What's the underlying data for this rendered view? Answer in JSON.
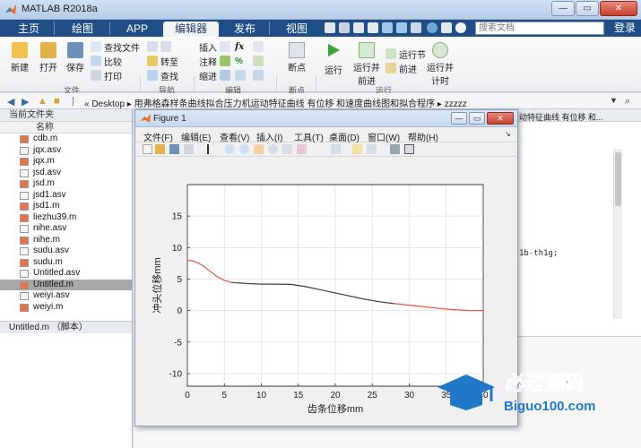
{
  "app": {
    "title": "MATLAB R2018a",
    "window_controls": [
      "—",
      "▭",
      "✕"
    ]
  },
  "ribbon_tabs": [
    {
      "label": "主页",
      "active": false
    },
    {
      "label": "绘图",
      "active": false
    },
    {
      "label": "APP",
      "active": false
    },
    {
      "label": "编辑器",
      "active": true
    },
    {
      "label": "发布",
      "active": false
    },
    {
      "label": "视图",
      "active": false
    }
  ],
  "search": {
    "placeholder": "搜索文档"
  },
  "login_label": "登录",
  "ribbon": {
    "file": {
      "new": "新建",
      "open": "打开",
      "save": "保存",
      "find_files": "查找文件",
      "compare": "比较",
      "print": "打印",
      "group": "文件"
    },
    "navigate": {
      "goto": "转至",
      "find": "查找",
      "group": "导航"
    },
    "edit": {
      "insert": "插入",
      "comment": "注释",
      "indent": "缩进",
      "group": "编辑"
    },
    "breakpoints": {
      "label": "断点",
      "group": "断点"
    },
    "run": {
      "run": "运行",
      "run_advance_1": "运行并",
      "run_advance_2": "前进",
      "run_section": "运行节",
      "advance": "前进",
      "run_time_1": "运行并",
      "run_time_2": "计时",
      "group": "运行"
    }
  },
  "address": {
    "path": "« Desktop ▸ 用弗格森样条曲线拟合压力机运动特征曲线 有位移 和速度曲线图和拟合程序 ▸ zzzzz"
  },
  "current_folder": {
    "title": "当前文件夹",
    "column": "名称",
    "files": [
      {
        "name": "cdb.m",
        "type": "m",
        "selected": false
      },
      {
        "name": "jqx.asv",
        "type": "asv",
        "selected": false
      },
      {
        "name": "jqx.m",
        "type": "m",
        "selected": false
      },
      {
        "name": "jsd.asv",
        "type": "asv",
        "selected": false
      },
      {
        "name": "jsd.m",
        "type": "m",
        "selected": false
      },
      {
        "name": "jsd1.asv",
        "type": "asv",
        "selected": false
      },
      {
        "name": "jsd1.m",
        "type": "m",
        "selected": false
      },
      {
        "name": "liezhu39.m",
        "type": "m",
        "selected": false
      },
      {
        "name": "nihe.asv",
        "type": "asv",
        "selected": false
      },
      {
        "name": "nihe.m",
        "type": "m",
        "selected": false
      },
      {
        "name": "sudu.asv",
        "type": "asv",
        "selected": false
      },
      {
        "name": "sudu.m",
        "type": "m",
        "selected": false
      },
      {
        "name": "Untitled.asv",
        "type": "asv",
        "selected": false
      },
      {
        "name": "Untitled.m",
        "type": "m",
        "selected": true
      },
      {
        "name": "weiyi.asv",
        "type": "asv",
        "selected": false
      },
      {
        "name": "weiyi.m",
        "type": "m",
        "selected": false
      }
    ],
    "detail_label": "Untitled.m （脚本）"
  },
  "editor": {
    "peek_title": "动特征曲线 有位移 和...",
    "code_peek": "1b-th1g;"
  },
  "figure": {
    "title": "Figure 1",
    "menu": [
      "文件(F)",
      "编辑(E)",
      "查看(V)",
      "插入(I)",
      "工具(T)",
      "桌面(D)",
      "窗口(W)",
      "帮助(H)"
    ]
  },
  "chart_data": {
    "type": "line",
    "xlabel": "齿条位移mm",
    "ylabel": "冲头位移mm",
    "xlim": [
      0,
      40
    ],
    "ylim": [
      -12,
      20
    ],
    "xticks": [
      0,
      5,
      10,
      15,
      20,
      25,
      30,
      35,
      40
    ],
    "yticks": [
      -10,
      -5,
      0,
      5,
      10,
      15
    ],
    "grid": true,
    "series": [
      {
        "color": "#e8553a",
        "x": [
          0,
          1,
          2,
          3,
          4,
          5,
          6
        ],
        "y": [
          8.0,
          7.8,
          7.2,
          6.3,
          5.4,
          4.8,
          4.45
        ]
      },
      {
        "color": "#404040",
        "x": [
          6,
          8,
          10,
          12,
          14,
          16,
          18,
          20,
          22,
          24,
          26,
          28
        ],
        "y": [
          4.45,
          4.3,
          4.2,
          4.2,
          4.15,
          3.8,
          3.3,
          2.8,
          2.3,
          1.8,
          1.4,
          1.1
        ]
      },
      {
        "color": "#e8553a",
        "x": [
          28,
          30,
          32,
          34,
          36,
          38,
          40
        ],
        "y": [
          1.1,
          0.85,
          0.6,
          0.35,
          0.15,
          0.02,
          0.0
        ]
      }
    ]
  },
  "watermark": {
    "main": "必过源码",
    "sub": "Biguo100.com"
  },
  "colors": {
    "tab_bg": "#1f4f86",
    "accent": "#2a7bc4"
  }
}
